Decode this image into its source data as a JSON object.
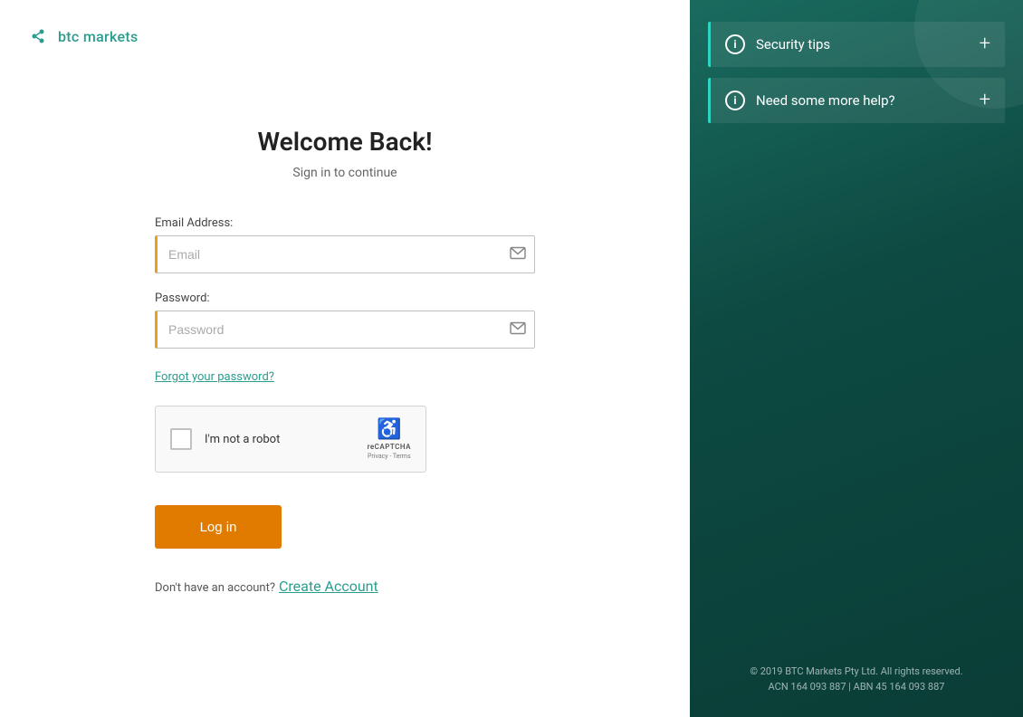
{
  "logo": {
    "text": "btc markets"
  },
  "form": {
    "title": "Welcome Back!",
    "subtitle": "Sign in to continue",
    "email_label": "Email Address:",
    "email_placeholder": "Email",
    "password_label": "Password:",
    "password_placeholder": "Password",
    "forgot_password": "Forgot your password?",
    "recaptcha_label": "I'm not a robot",
    "recaptcha_brand": "reCAPTCHA",
    "recaptcha_links": "Privacy - Terms",
    "login_button": "Log in",
    "no_account_text": "Don't have an account?",
    "create_account_link": "Create Account"
  },
  "right_panel": {
    "accordion_1": {
      "label": "Security tips",
      "plus": "+"
    },
    "accordion_2": {
      "label": "Need some more help?",
      "plus": "+"
    },
    "footer": {
      "line1": "© 2019 BTC Markets Pty Ltd. All rights reserved.",
      "line2": "ACN 164 093 887 | ABN 45 164 093 887"
    }
  },
  "colors": {
    "accent_teal": "#2a9d8f",
    "accent_orange": "#e07b00",
    "dark_bg": "#0d4a42"
  }
}
